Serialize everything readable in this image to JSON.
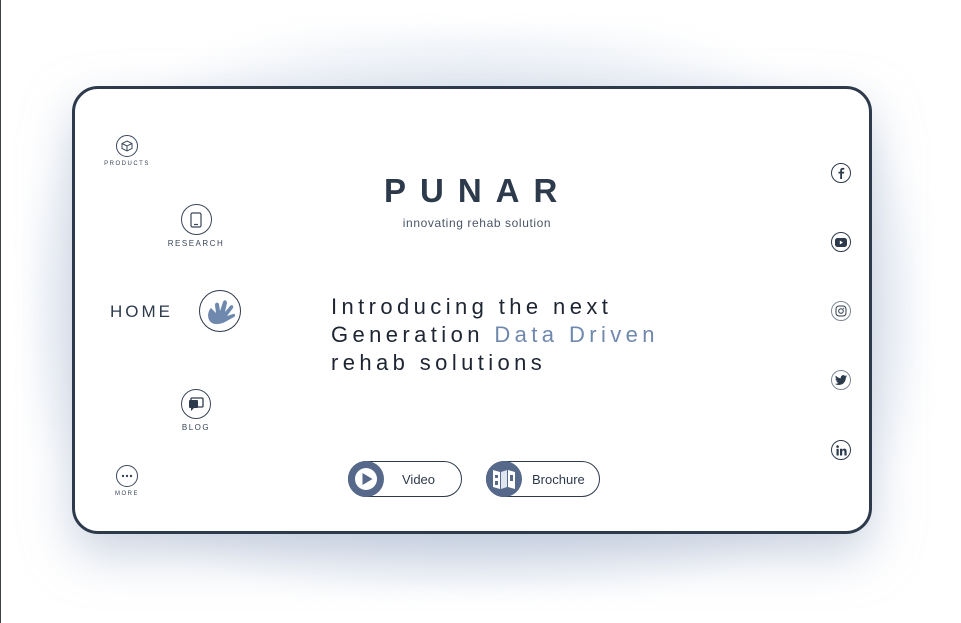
{
  "brand": {
    "title": "PUNAR",
    "tagline": "innovating rehab solution"
  },
  "nav": {
    "products": "PRODUCTS",
    "research": "RESEARCH",
    "home": "HOME",
    "blog": "BLOG",
    "more": "MORE"
  },
  "hero": {
    "line1": "Introducing the next",
    "line2_prefix": "Generation ",
    "line2_accent": "Data Driven",
    "line3": "rehab solutions"
  },
  "buttons": {
    "video": "Video",
    "brochure": "Brochure"
  },
  "social": [
    "facebook-icon",
    "youtube-icon",
    "instagram-icon",
    "twitter-icon",
    "linkedin-icon"
  ],
  "colors": {
    "primary": "#2d3a4c",
    "accent": "#6f88ad",
    "button_icon_bg": "#56698a"
  }
}
